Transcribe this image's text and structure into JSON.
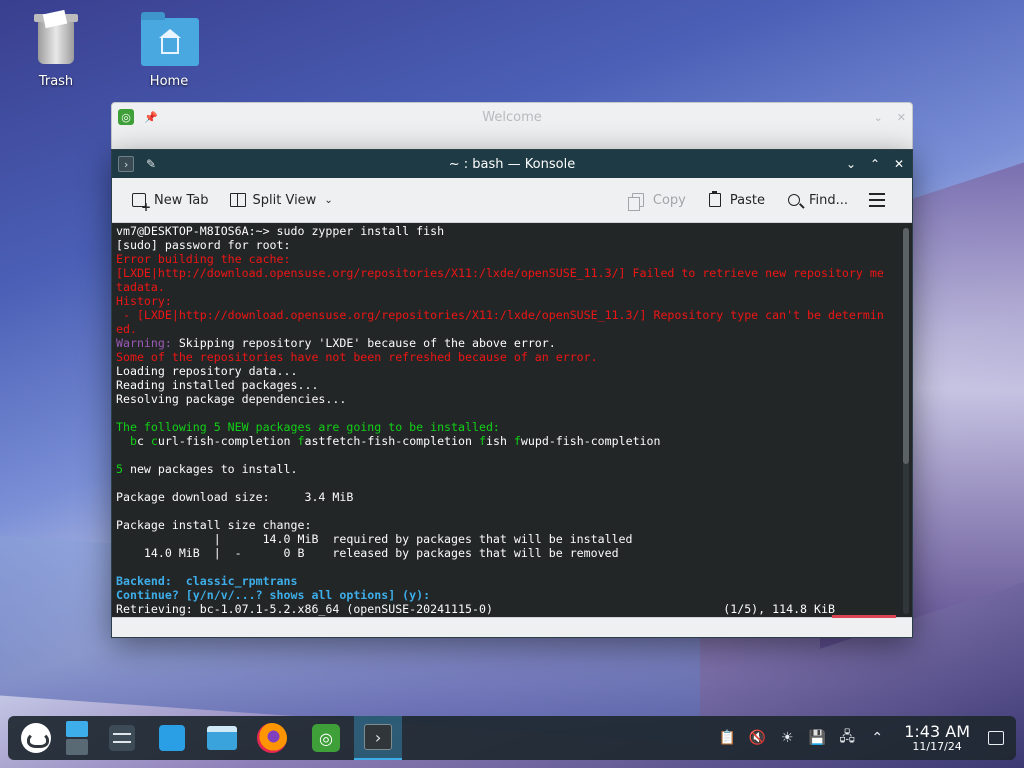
{
  "desktop": {
    "icons": [
      {
        "label": "Trash"
      },
      {
        "label": "Home"
      }
    ]
  },
  "welcome_window": {
    "title": "Welcome"
  },
  "konsole": {
    "title": "~ : bash — Konsole",
    "toolbar": {
      "new_tab": "New Tab",
      "split_view": "Split View",
      "copy": "Copy",
      "paste": "Paste",
      "find": "Find..."
    },
    "terminal_lines": [
      [
        {
          "t": "vm7@DESKTOP-M8IOS6A:~> sudo zypper install fish",
          "c": "c-white"
        }
      ],
      [
        {
          "t": "[sudo] password for root:",
          "c": "c-white"
        }
      ],
      [
        {
          "t": "Error building the cache:",
          "c": "c-red"
        }
      ],
      [
        {
          "t": "[LXDE|http://download.opensuse.org/repositories/X11:/lxde/openSUSE_11.3/] Failed to retrieve new repository me",
          "c": "c-red"
        }
      ],
      [
        {
          "t": "tadata.",
          "c": "c-red"
        }
      ],
      [
        {
          "t": "History:",
          "c": "c-red"
        }
      ],
      [
        {
          "t": " - [LXDE|http://download.opensuse.org/repositories/X11:/lxde/openSUSE_11.3/] Repository type can't be determin",
          "c": "c-red"
        }
      ],
      [
        {
          "t": "ed.",
          "c": "c-red"
        }
      ],
      [
        {
          "t": "Warning:",
          "c": "c-purple"
        },
        {
          "t": " Skipping repository 'LXDE' because of the above error.",
          "c": "c-white"
        }
      ],
      [
        {
          "t": "Some of the repositories have not been refreshed because of an error.",
          "c": "c-red"
        }
      ],
      [
        {
          "t": "Loading repository data...",
          "c": "c-white"
        }
      ],
      [
        {
          "t": "Reading installed packages...",
          "c": "c-white"
        }
      ],
      [
        {
          "t": "Resolving package dependencies...",
          "c": "c-white"
        }
      ],
      [
        {
          "t": "",
          "c": "c-white"
        }
      ],
      [
        {
          "t": "The following 5 NEW packages are going to be installed:",
          "c": "c-green2"
        }
      ],
      [
        {
          "t": "  ",
          "c": "c-white"
        },
        {
          "t": "b",
          "c": "c-green2"
        },
        {
          "t": "c ",
          "c": "c-white"
        },
        {
          "t": "c",
          "c": "c-green2"
        },
        {
          "t": "url-fish-completion ",
          "c": "c-white"
        },
        {
          "t": "f",
          "c": "c-green2"
        },
        {
          "t": "astfetch-fish-completion ",
          "c": "c-white"
        },
        {
          "t": "f",
          "c": "c-green2"
        },
        {
          "t": "ish ",
          "c": "c-white"
        },
        {
          "t": "f",
          "c": "c-green2"
        },
        {
          "t": "wupd-fish-completion",
          "c": "c-white"
        }
      ],
      [
        {
          "t": "",
          "c": "c-white"
        }
      ],
      [
        {
          "t": "5",
          "c": "c-green2"
        },
        {
          "t": " new packages to install.",
          "c": "c-white"
        }
      ],
      [
        {
          "t": "",
          "c": "c-white"
        }
      ],
      [
        {
          "t": "Package download size:     3.4 MiB",
          "c": "c-white"
        }
      ],
      [
        {
          "t": "",
          "c": "c-white"
        }
      ],
      [
        {
          "t": "Package install size change:",
          "c": "c-white"
        }
      ],
      [
        {
          "t": "              |      14.0 MiB  required by packages that will be installed",
          "c": "c-white"
        }
      ],
      [
        {
          "t": "    14.0 MiB  |  -      0 B    released by packages that will be removed",
          "c": "c-white"
        }
      ],
      [
        {
          "t": "",
          "c": "c-white"
        }
      ],
      [
        {
          "t": "Backend:",
          "c": "c-blue"
        },
        {
          "t": "  classic_rpmtrans",
          "c": "c-blue"
        }
      ],
      [
        {
          "t": "Continue? [y/n/v/...? shows all options] (y):",
          "c": "c-blue"
        }
      ],
      [
        {
          "t": "Retrieving: bc-1.07.1-5.2.x86_64 (openSUSE-20241115-0)                                 (1/5), 114.8 KiB",
          "c": "c-white"
        }
      ]
    ]
  },
  "taskbar": {
    "clock_time": "1:43 AM",
    "clock_date": "11/17/24"
  },
  "colors": {
    "accent": "#3daee9",
    "konsole_titlebar": "#1e3a44",
    "terminal_bg": "#232627"
  },
  "icons": [
    "trash-icon",
    "home-folder-icon",
    "pin-icon",
    "new-tab-icon",
    "split-view-icon",
    "copy-icon",
    "paste-icon",
    "search-icon",
    "hamburger-menu-icon",
    "opensuse-icon",
    "pager-icon",
    "system-settings-icon",
    "discover-icon",
    "dolphin-icon",
    "firefox-icon",
    "welcome-icon",
    "konsole-icon",
    "clipboard-icon",
    "volume-muted-icon",
    "brightness-icon",
    "save-icon",
    "network-icon",
    "chevron-up-icon",
    "show-desktop-icon"
  ]
}
